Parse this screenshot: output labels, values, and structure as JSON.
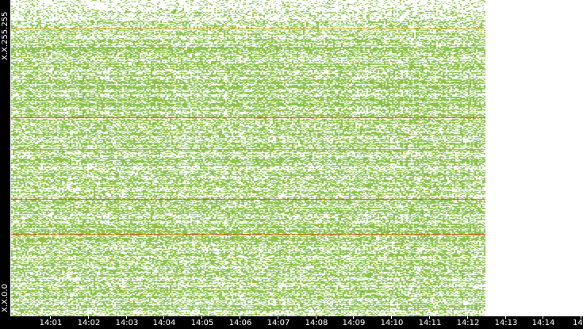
{
  "chart_data": {
    "type": "heatmap",
    "title": "",
    "xlabel": "",
    "ylabel": "",
    "y_axis": {
      "top_label": "X.X.255.255",
      "bottom_label": "X.X.0.0"
    },
    "x_axis": {
      "ticks": [
        "14:01",
        "14:02",
        "14:03",
        "14:04",
        "14:05",
        "14:06",
        "14:07",
        "14:08",
        "14:09",
        "14:10",
        "14:11",
        "14:12",
        "14:13",
        "14:14",
        "14"
      ],
      "data_start_time": "14:00:30",
      "data_end_time": "14:12:30"
    },
    "colors": {
      "background": "#ffffff",
      "axis_band": "#000000",
      "axis_text": "#ffffff",
      "low": "#8bc34a",
      "mid": "#7cb342",
      "elevated": "#c8a000",
      "high": "#d84315"
    },
    "intensity_levels": [
      "low",
      "mid",
      "elevated",
      "high"
    ],
    "hot_rows": [
      {
        "address_fraction": 0.63,
        "level": "high"
      },
      {
        "address_fraction": 0.37,
        "level": "high"
      },
      {
        "address_fraction": 0.26,
        "level": "high"
      },
      {
        "address_fraction": 0.91,
        "level": "elevated"
      },
      {
        "address_fraction": 0.53,
        "level": "elevated"
      }
    ],
    "grid": false,
    "legend": "none"
  }
}
